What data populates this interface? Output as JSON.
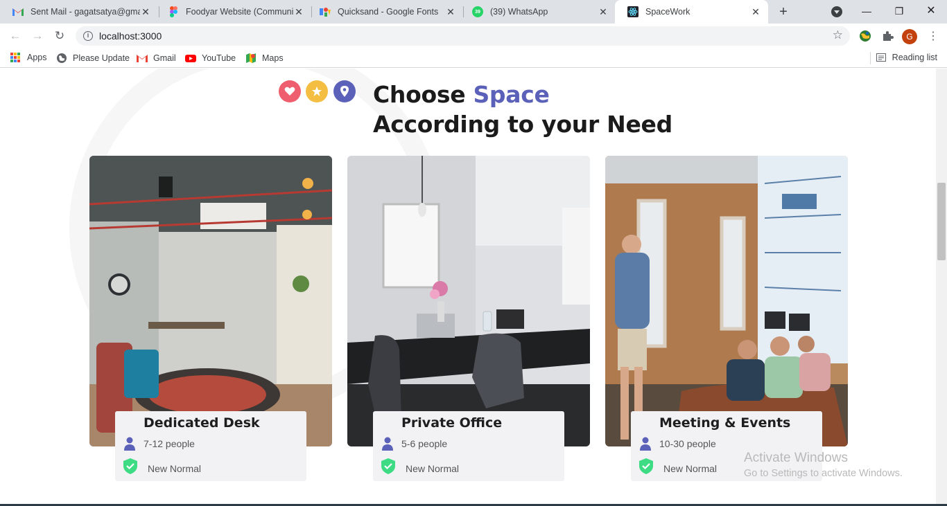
{
  "tabs": [
    {
      "title": "Sent Mail - gagatsatya@gmail",
      "favicon": "gmail-icon"
    },
    {
      "title": "Foodyar Website (Community",
      "favicon": "figma-icon"
    },
    {
      "title": "Quicksand - Google Fonts",
      "favicon": "google-fonts-icon"
    },
    {
      "title": "(39) WhatsApp",
      "favicon": "whatsapp-icon",
      "count": "39"
    },
    {
      "title": "SpaceWork",
      "favicon": "react-icon",
      "active": true
    }
  ],
  "toolbar": {
    "url": "localhost:3000",
    "profile_initial": "G"
  },
  "bookmarks": [
    {
      "label": "Apps",
      "icon": "apps-grid-icon"
    },
    {
      "label": "Please Update",
      "icon": "globe-icon"
    },
    {
      "label": "Gmail",
      "icon": "gmail-icon"
    },
    {
      "label": "YouTube",
      "icon": "youtube-icon"
    },
    {
      "label": "Maps",
      "icon": "maps-icon"
    }
  ],
  "reading_list": "Reading list",
  "section": {
    "heading_line1_prefix": "Choose ",
    "heading_line1_accent": "Space",
    "heading_line2": "According to your Need",
    "accent_color": "#5b61b9"
  },
  "cards": [
    {
      "title": "Dedicated Desk",
      "people": "7-12 people",
      "tag": "New Normal",
      "image": "coworking-lounge-photo"
    },
    {
      "title": "Private Office",
      "people": "5-6 people",
      "tag": "New Normal",
      "image": "private-office-photo"
    },
    {
      "title": "Meeting & Events",
      "people": "10-30 people",
      "tag": "New Normal",
      "image": "meeting-presentation-photo"
    }
  ],
  "watermark": {
    "line1": "Activate Windows",
    "line2": "Go to Settings to activate Windows."
  }
}
